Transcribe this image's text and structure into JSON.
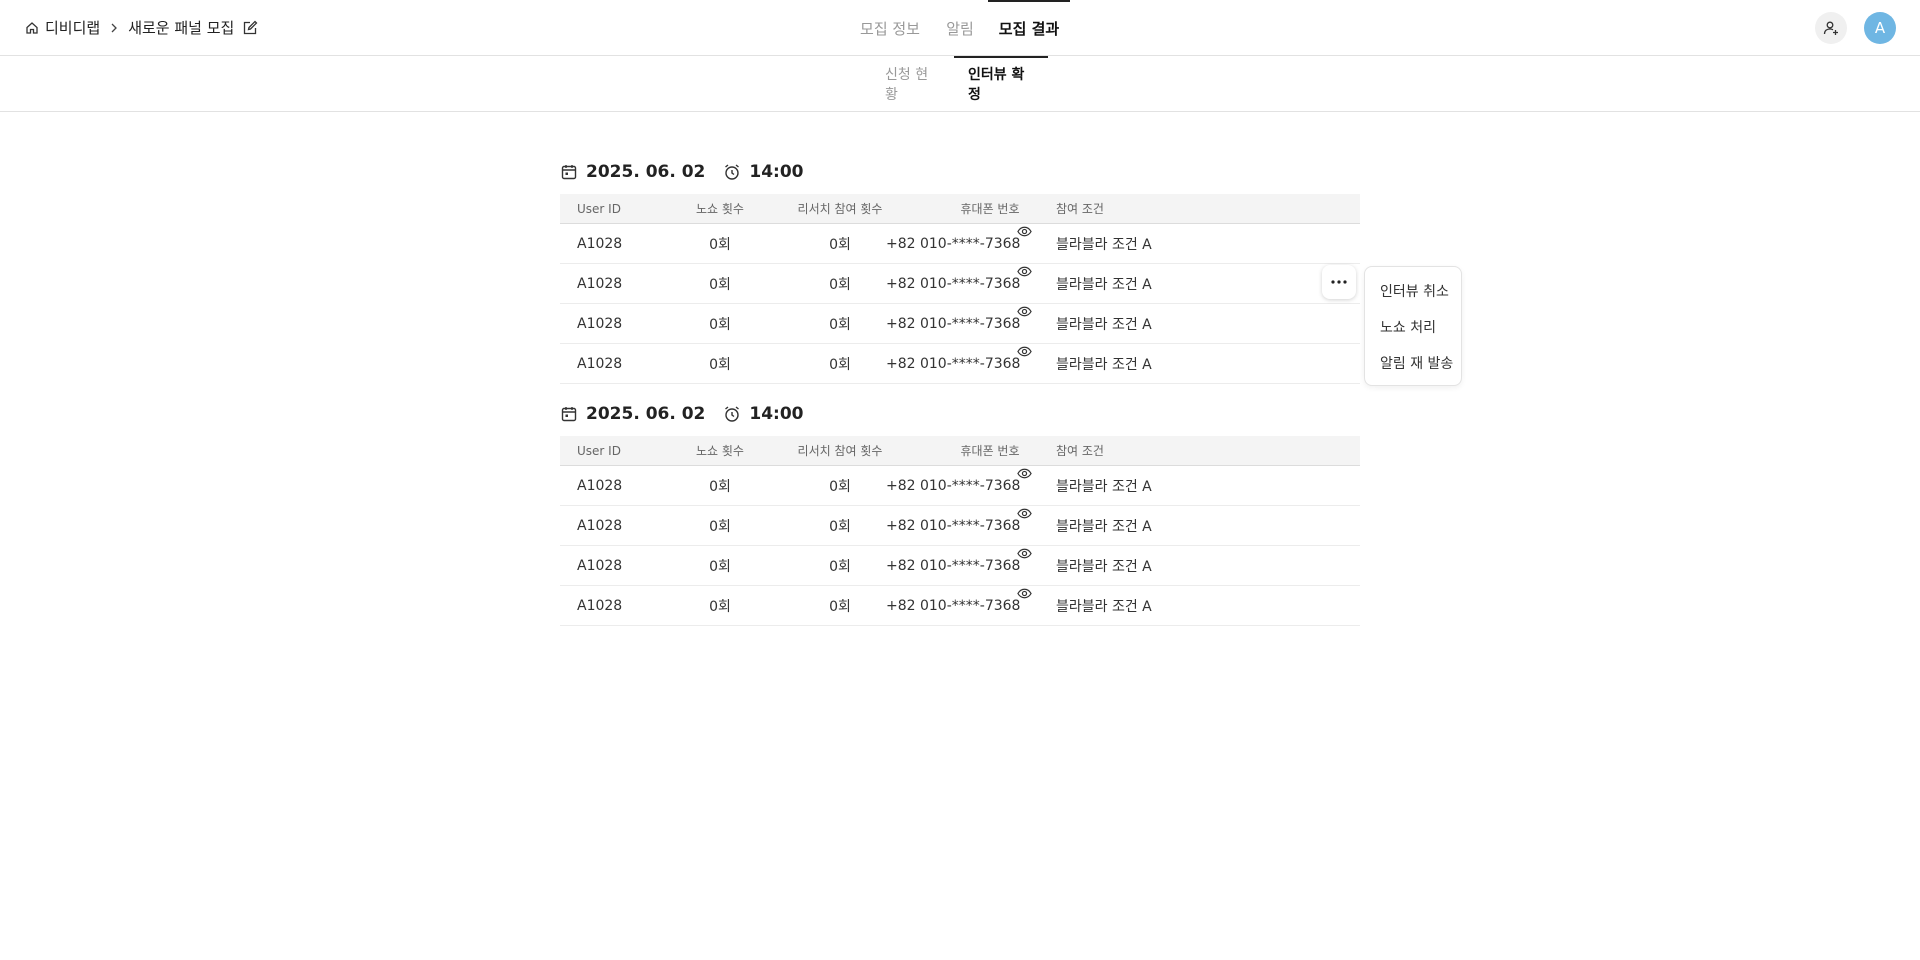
{
  "header": {
    "breadcrumb": {
      "root": "디비디랩",
      "current": "새로운 패널 모집"
    },
    "tabs": [
      {
        "label": "모집 정보"
      },
      {
        "label": "알림"
      },
      {
        "label": "모집 결과"
      }
    ],
    "active_tab": "모집 결과",
    "avatar_initial": "A"
  },
  "subtabs": [
    {
      "label": "신청 현황"
    },
    {
      "label": "인터뷰 확정"
    }
  ],
  "active_subtab": "인터뷰 확정",
  "table_columns": {
    "user_id": "User ID",
    "noshow": "노쇼 횟수",
    "research_count": "리서치 참여 횟수",
    "phone": "휴대폰 번호",
    "condition": "참여 조건"
  },
  "groups": [
    {
      "date": "2025. 06. 02",
      "time": "14:00",
      "rows": [
        {
          "user_id": "A1028",
          "noshow": "0회",
          "research_count": "0회",
          "phone": "+82 010-****-7368",
          "condition": "블라블라 조건 A"
        },
        {
          "user_id": "A1028",
          "noshow": "0회",
          "research_count": "0회",
          "phone": "+82 010-****-7368",
          "condition": "블라블라 조건 A"
        },
        {
          "user_id": "A1028",
          "noshow": "0회",
          "research_count": "0회",
          "phone": "+82 010-****-7368",
          "condition": "블라블라 조건 A"
        },
        {
          "user_id": "A1028",
          "noshow": "0회",
          "research_count": "0회",
          "phone": "+82 010-****-7368",
          "condition": "블라블라 조건 A"
        }
      ]
    },
    {
      "date": "2025. 06. 02",
      "time": "14:00",
      "rows": [
        {
          "user_id": "A1028",
          "noshow": "0회",
          "research_count": "0회",
          "phone": "+82 010-****-7368",
          "condition": "블라블라 조건 A"
        },
        {
          "user_id": "A1028",
          "noshow": "0회",
          "research_count": "0회",
          "phone": "+82 010-****-7368",
          "condition": "블라블라 조건 A"
        },
        {
          "user_id": "A1028",
          "noshow": "0회",
          "research_count": "0회",
          "phone": "+82 010-****-7368",
          "condition": "블라블라 조건 A"
        },
        {
          "user_id": "A1028",
          "noshow": "0회",
          "research_count": "0회",
          "phone": "+82 010-****-7368",
          "condition": "블라블라 조건 A"
        }
      ]
    }
  ],
  "row_menu": {
    "items": [
      {
        "label": "인터뷰 취소"
      },
      {
        "label": "노쇼 처리"
      },
      {
        "label": "알림 재 발송"
      }
    ]
  },
  "colors": {
    "avatar": "#6fb6e3",
    "active_text": "#111111",
    "inactive_text": "#999999"
  }
}
